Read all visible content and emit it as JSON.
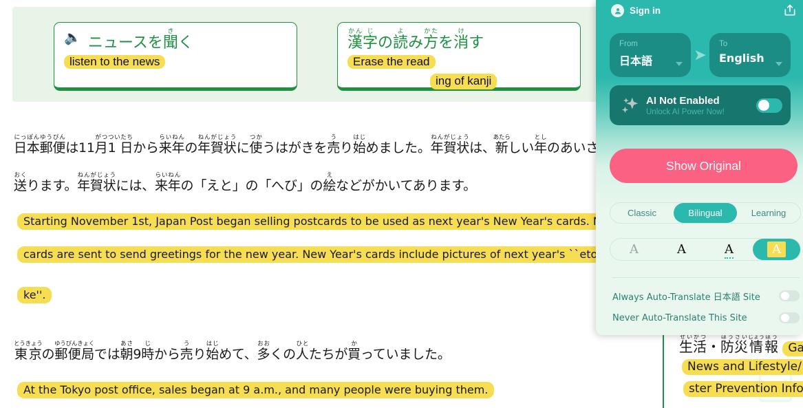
{
  "page": {
    "toolbar": {
      "buttons": [
        {
          "icon": "speaker-icon",
          "jp_parts": [
            {
              "base": "ニュースを",
              "ruby": ""
            },
            {
              "base": "聞",
              "ruby": "き"
            },
            {
              "base": "く",
              "ruby": ""
            }
          ],
          "jp_text": "ニュースを聞く",
          "translation": "listen to the news"
        },
        {
          "icon": "",
          "jp_parts": [
            {
              "base": "漢",
              "ruby": "かん"
            },
            {
              "base": "字",
              "ruby": "じ"
            },
            {
              "base": "の",
              "ruby": ""
            },
            {
              "base": "読",
              "ruby": "よ"
            },
            {
              "base": "み",
              "ruby": ""
            },
            {
              "base": "方",
              "ruby": "かた"
            },
            {
              "base": "を",
              "ruby": ""
            },
            {
              "base": "消",
              "ruby": "け"
            },
            {
              "base": "す",
              "ruby": ""
            }
          ],
          "jp_text": "漢字の読み方を消す",
          "translation": "Erase the read",
          "translation_2": "ing of kanji"
        }
      ]
    },
    "article": {
      "jp_line_1": "日本郵便は11月1日から来年の年賀状に使うはがきを売り始めました。年賀状は、新しい年のあいさつをするため",
      "jp_line_2": "送ります。年賀状には、来年の「えと」の「へび」の絵などがかいてあります。",
      "jp_line_3": "東京の郵便局では朝9時から売り始めて、多くの人たちが買っていました。",
      "en_line_1": "Starting November 1st, Japan Post began selling postcards to be used as next year's New Year's cards. New Yea",
      "en_line_2": "cards are sent to send greetings for the new year. New Year's cards include pictures of next year's ``eto'' and ``",
      "en_line_3": "ke''.",
      "en_line_4": "At the Tokyo post office, sales began at 9 a.m., and many people were buying them."
    },
    "sidebar": {
      "jp_heading": "生活・防災情報",
      "heading_tail": "Gako",
      "en_line_1": "News and Lifestyle/",
      "en_line_2": "ster Prevention Infor"
    }
  },
  "panel": {
    "signin": {
      "label": "Sign in",
      "avatar_icon": "user-avatar-icon"
    },
    "share_icon": "share-external-icon",
    "language": {
      "from_caption": "From",
      "from_value": "日本語",
      "swap_icon": "arrow-right-icon",
      "to_caption": "To",
      "to_value": "English"
    },
    "ai": {
      "icon": "sparkle-icon",
      "title": "AI Not Enabled",
      "subtitle": "Unlock AI Power Now!",
      "enabled": false
    },
    "show_original_label": "Show Original",
    "modes": [
      {
        "label": "Classic",
        "active": false
      },
      {
        "label": "Bilingual",
        "active": true
      },
      {
        "label": "Learning",
        "active": false
      }
    ],
    "styles": [
      {
        "label": "A",
        "variant": "gray",
        "active": false
      },
      {
        "label": "A",
        "variant": "black",
        "active": false
      },
      {
        "label": "A",
        "variant": "dotted-underline",
        "active": false
      },
      {
        "label": "A",
        "variant": "highlight",
        "active": true
      }
    ],
    "settings": [
      {
        "label": "Always Auto-Translate 日本語 Site",
        "enabled": false
      },
      {
        "label": "Never Auto-Translate This Site",
        "enabled": false
      }
    ],
    "colors": {
      "teal": "#2bb8ad",
      "dark_teal": "#17776f",
      "pink": "#fa6182",
      "highlight_yellow": "#f7dd52",
      "green": "#1e9141"
    }
  }
}
